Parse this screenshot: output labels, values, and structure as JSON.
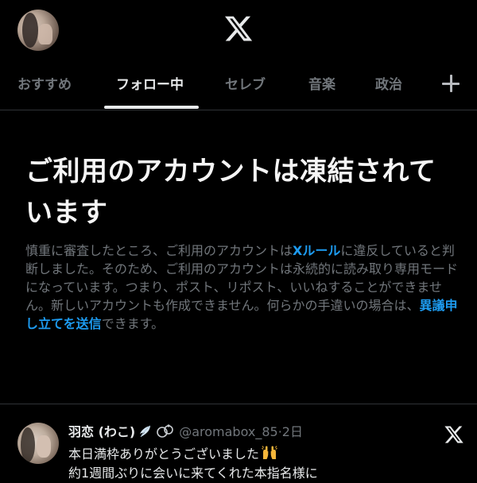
{
  "header": {
    "logo_icon": "x-logo-icon"
  },
  "tabs": [
    {
      "label": "おすすめ"
    },
    {
      "label": "フォロー中",
      "active": true
    },
    {
      "label": "セレブ"
    },
    {
      "label": "音楽"
    },
    {
      "label": "政治"
    }
  ],
  "tabs_add_icon": "plus-icon",
  "notice": {
    "title": "ご利用のアカウントは凍結されています",
    "body_1": "慎重に審査したところ、ご利用のアカウントは",
    "rules_link": "Xルール",
    "body_2": "に違反していると判断しました。そのため、ご利用のアカウントは永続的に読み取り専用モードになっています。つまり、ポスト、リポスト、いいねすることができません。新しいアカウントも作成できません。何らかの手違いの場合は、",
    "appeal_link": "異議申し立てを送信",
    "body_3": "できます。"
  },
  "post": {
    "display_name": "羽恋 (わこ)",
    "handle": "@aromabox_85",
    "separator": "·",
    "time": "2日",
    "text_line_1": "本日満枠ありがとうございました",
    "text_line_2": "約1週間ぶりに会いに来てくれた本指名様に"
  },
  "colors": {
    "background": "#000000",
    "text_primary": "#e7e9ea",
    "text_secondary": "#71767b",
    "link": "#1d9bf0",
    "divider": "#2f3336"
  }
}
